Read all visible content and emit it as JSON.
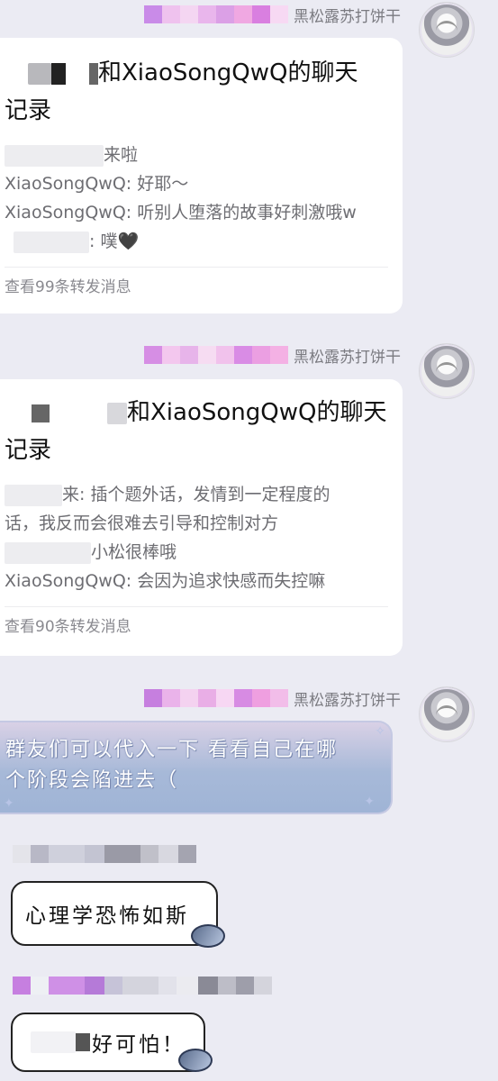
{
  "sender_name": "黑松露苏打饼干",
  "messages": [
    {
      "type": "forward_card",
      "title_part1": "和XiaoSongQwQ的聊天",
      "title_part2": "记录",
      "lines": [
        "来啦",
        "XiaoSongQwQ: 好耶～",
        "XiaoSongQwQ: 听别人堕落的故事好刺激哦w",
        ": 噗🖤"
      ],
      "footer": "查看99条转发消息"
    },
    {
      "type": "forward_card",
      "title_part1": "和XiaoSongQwQ的聊天",
      "title_part2": "记录",
      "lines": [
        "来: 插个题外话，发情到一定程度的",
        "话，我反而会很难去引导和控制对方",
        "小松很棒哦",
        "XiaoSongQwQ: 会因为追求快感而失控嘛"
      ],
      "footer": "查看90条转发消息"
    },
    {
      "type": "text",
      "text_line1": "群友们可以代入一下 看看自己在哪",
      "text_line2": "个阶段会陷进去（"
    }
  ],
  "other_messages": [
    {
      "text": "心理学恐怖如斯"
    },
    {
      "text": "好可怕！"
    }
  ],
  "icons": [
    "avatar",
    "fish-sticker-icon"
  ]
}
